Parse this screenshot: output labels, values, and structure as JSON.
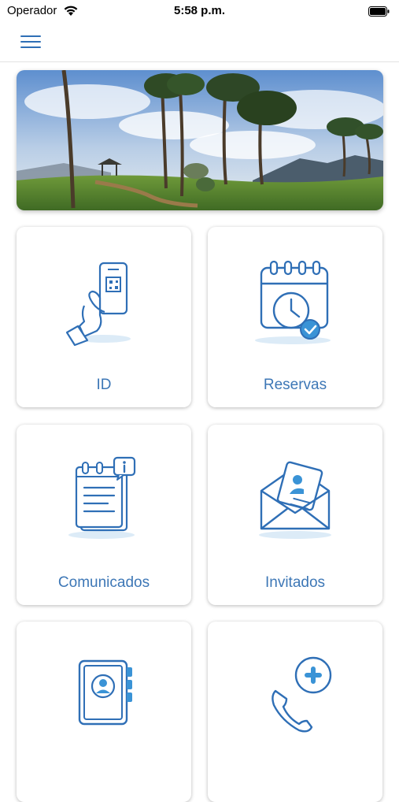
{
  "status_bar": {
    "carrier": "Operador",
    "time": "5:58 p.m.",
    "icons": [
      "wifi-icon",
      "battery-icon"
    ]
  },
  "nav": {
    "menu_icon": "hamburger-menu-icon"
  },
  "hero": {
    "image": "park landscape with trees and gazebo"
  },
  "colors": {
    "accent": "#2f6fb6",
    "label": "#3d77b6",
    "icon_fill": "#dcebf7"
  },
  "tiles": [
    {
      "label": "ID",
      "icon": "phone-qr-hand-icon"
    },
    {
      "label": "Reservas",
      "icon": "calendar-clock-check-icon"
    },
    {
      "label": "Comunicados",
      "icon": "notepad-info-icon"
    },
    {
      "label": "Invitados",
      "icon": "envelope-contact-icon"
    },
    {
      "label": "",
      "icon": "address-book-icon"
    },
    {
      "label": "",
      "icon": "phone-medical-icon"
    }
  ]
}
